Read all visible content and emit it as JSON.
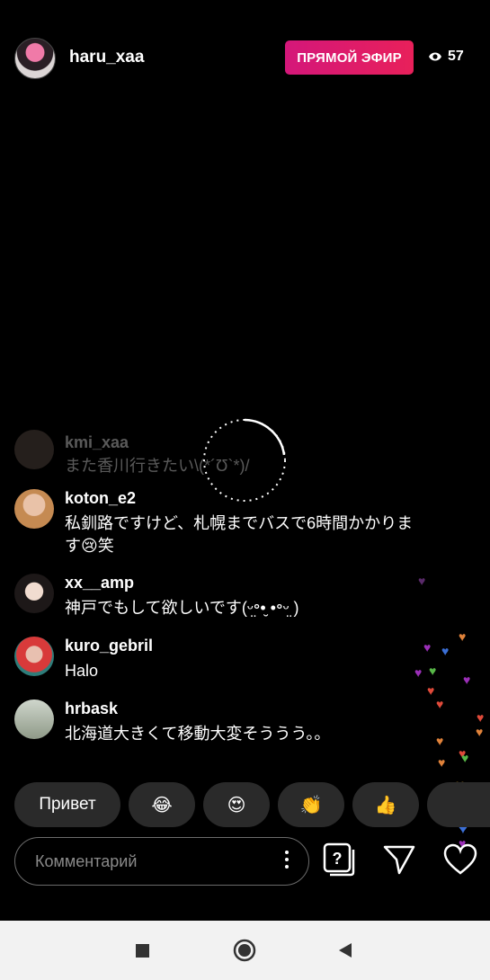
{
  "header": {
    "username": "haru_xaa",
    "live_label": "ПРЯМОЙ ЭФИР",
    "viewer_count": "57",
    "live_color": "#d81b74"
  },
  "comments": [
    {
      "user": "kmi_xaa",
      "text": "また香川行きたい\\(*´Ʊ`*)/",
      "faded": true
    },
    {
      "user": "koton_e2",
      "text": "私釧路ですけど、札幌までバスで6時間かかります😢笑"
    },
    {
      "user": "xx__amp",
      "text": "神戸でもして欲しいです(ᵕ̤॰•̮ •॰ᵕ̤ )"
    },
    {
      "user": "kuro_gebril",
      "text": "Halo"
    },
    {
      "user": "hrbask",
      "text": "北海道大きくて移動大変そううう。。"
    }
  ],
  "quick_replies": {
    "text_label": "Привет",
    "emojis": [
      "😂",
      "😍",
      "👏",
      "👍"
    ]
  },
  "comment_input": {
    "placeholder": "Комментарий"
  },
  "icons": {
    "viewers": "eye-icon",
    "question": "question-icon",
    "send": "send-icon",
    "like": "heart-icon"
  }
}
